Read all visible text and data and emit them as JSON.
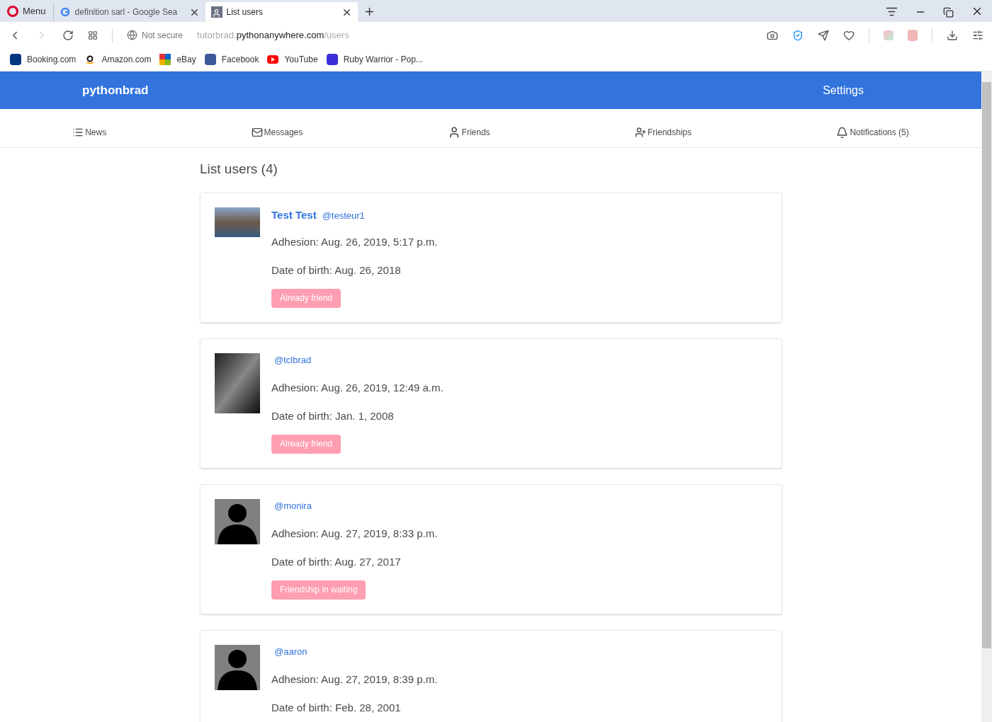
{
  "browser": {
    "menu": "Menu",
    "tabs": [
      {
        "title": "definition sarl - Google Sea",
        "kind": "google",
        "selected": false
      },
      {
        "title": "List users",
        "kind": "page",
        "selected": true
      }
    ],
    "security": "Not secure",
    "url": {
      "subdomain": "tutorbrad.",
      "domain": "pythonanywhere.com",
      "path": "/users"
    },
    "bookmarks": [
      {
        "label": "Booking.com",
        "kind": "booking"
      },
      {
        "label": "Amazon.com",
        "kind": "amazon"
      },
      {
        "label": "eBay",
        "kind": "ebay"
      },
      {
        "label": "Facebook",
        "kind": "facebook"
      },
      {
        "label": "YouTube",
        "kind": "youtube"
      },
      {
        "label": "Ruby Warrior - Pop...",
        "kind": "ruby"
      }
    ]
  },
  "header": {
    "brand": "pythonbrad",
    "settings": "Settings"
  },
  "nav": [
    {
      "label": "News",
      "kind": "news"
    },
    {
      "label": "Messages",
      "kind": "messages"
    },
    {
      "label": "Friends",
      "kind": "friends"
    },
    {
      "label": "Friendships",
      "kind": "friendships"
    },
    {
      "label": "Notifications (5)",
      "kind": "notifications"
    }
  ],
  "page_title": "List users (4)",
  "users": [
    {
      "name": "Test Test",
      "handle": "@testeur1",
      "kind": "photo",
      "adhesion": "Adhesion: Aug. 26, 2019, 5:17 p.m.",
      "birth": "Date of birth: Aug. 26, 2018",
      "status": "Already friend"
    },
    {
      "handle": "@tclbrad",
      "kind": "dark-photo",
      "adhesion": "Adhesion: Aug. 26, 2019, 12:49 a.m.",
      "birth": "Date of birth: Jan. 1, 2008",
      "status": "Already friend"
    },
    {
      "handle": "@monira",
      "kind": "silhouette",
      "adhesion": "Adhesion: Aug. 27, 2019, 8:33 p.m.",
      "birth": "Date of birth: Aug. 27, 2017",
      "status": "Friendship in waiting"
    },
    {
      "handle": "@aaron",
      "kind": "silhouette",
      "adhesion": "Adhesion: Aug. 27, 2019, 8:39 p.m.",
      "birth": "Date of birth: Feb. 28, 2001"
    }
  ]
}
